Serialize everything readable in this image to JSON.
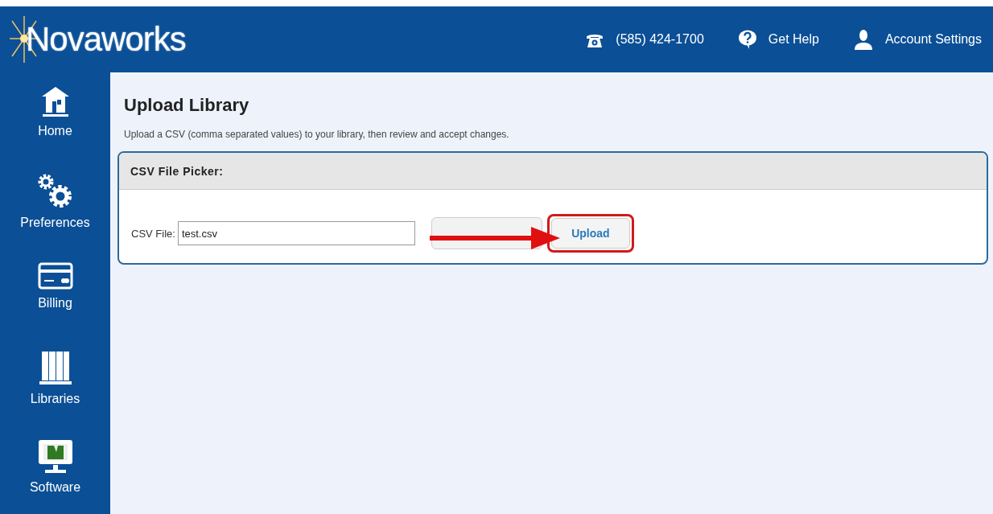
{
  "header": {
    "logo": "Novaworks",
    "links": [
      {
        "kind": "phone",
        "label": "(585) 424-1700"
      },
      {
        "kind": "help",
        "label": "Get Help"
      },
      {
        "kind": "account",
        "label": "Account Settings"
      }
    ]
  },
  "sidebar": {
    "items": [
      {
        "kind": "home",
        "label": "Home"
      },
      {
        "kind": "preferences",
        "label": "Preferences"
      },
      {
        "kind": "billing",
        "label": "Billing"
      },
      {
        "kind": "libraries",
        "label": "Libraries"
      },
      {
        "kind": "software",
        "label": "Software"
      }
    ]
  },
  "page": {
    "title": "Upload Library",
    "description": "Upload a CSV (comma separated values) to your library, then review and accept changes."
  },
  "panel": {
    "title": "CSV File Picker:",
    "field_label": "CSV File:",
    "file_value": "test.csv",
    "upload_button": "Upload",
    "upload_highlighted": true
  }
}
